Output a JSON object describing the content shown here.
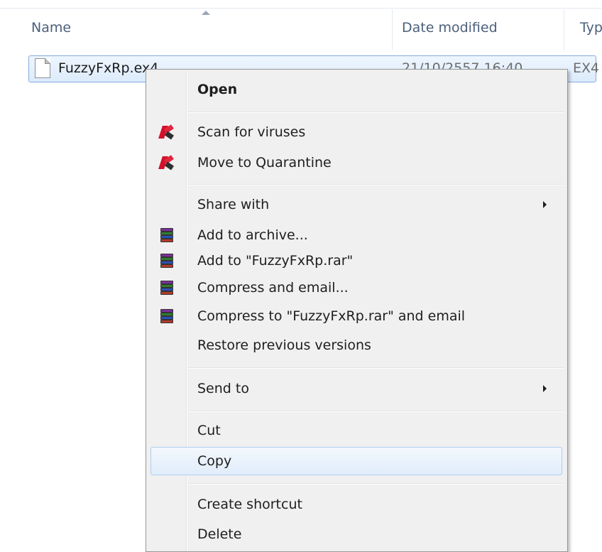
{
  "explorer": {
    "columns": {
      "name": "Name",
      "date_modified": "Date modified",
      "type": "Typ"
    },
    "file": {
      "name": "FuzzyFxRp.ex4",
      "date_modified": "21/10/2557 16:40",
      "type": "EX4"
    }
  },
  "context_menu": {
    "open": "Open",
    "scan": "Scan for viruses",
    "quarantine": "Move to Quarantine",
    "share_with": "Share with",
    "add_archive": "Add to archive...",
    "add_to_rar": "Add to \"FuzzyFxRp.rar\"",
    "compress_email": "Compress and email...",
    "compress_rar_email": "Compress to \"FuzzyFxRp.rar\" and email",
    "restore": "Restore previous versions",
    "send_to": "Send to",
    "cut": "Cut",
    "copy": "Copy",
    "create_shortcut": "Create shortcut",
    "delete": "Delete"
  },
  "icons": {
    "scan": "kaspersky-icon",
    "quarantine": "kaspersky-icon",
    "winrar": "winrar-books-icon"
  },
  "colors": {
    "selection_border": "#84acdd",
    "menu_background": "#f0f0f0",
    "hover_border": "#aeccf1"
  }
}
